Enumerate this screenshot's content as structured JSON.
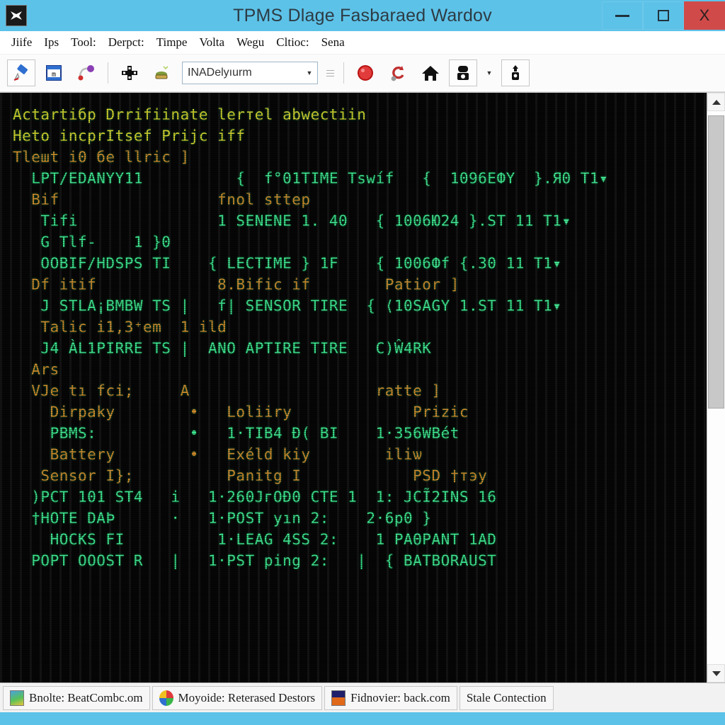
{
  "window": {
    "title": "TPMS Dlage Fasbaraed Wardov",
    "app_icon": "app-icon",
    "controls": {
      "minimize": "–",
      "maximize": "□",
      "close": "X"
    }
  },
  "menubar": {
    "items": [
      {
        "label": "Jiife",
        "hotkey": "J"
      },
      {
        "label": "Ips",
        "hotkey": "I"
      },
      {
        "label": "Tool:",
        "hotkey": "T"
      },
      {
        "label": "Derpct:",
        "hotkey": "D"
      },
      {
        "label": "Timpe",
        "hotkey": ""
      },
      {
        "label": "Volta",
        "hotkey": ""
      },
      {
        "label": "Wegu",
        "hotkey": ""
      },
      {
        "label": "Cltioc:",
        "hotkey": ""
      },
      {
        "label": "Sena",
        "hotkey": ""
      }
    ]
  },
  "toolbar": {
    "buttons": [
      {
        "name": "pen-tool-button",
        "glyph": "✎"
      },
      {
        "name": "table-view-button",
        "glyph": "▦"
      },
      {
        "name": "connect-node-button",
        "glyph": "⚭"
      },
      {
        "name": "grid-layout-button",
        "glyph": "✣"
      },
      {
        "name": "tray-open-button",
        "glyph": "☗"
      }
    ],
    "combo": {
      "value": "INADelyıurm",
      "placeholder": "INADelyıurm"
    },
    "right_buttons": [
      {
        "name": "record-stop-button",
        "glyph": "⬤"
      },
      {
        "name": "refresh-loop-button",
        "glyph": "↻"
      },
      {
        "name": "home-button",
        "glyph": "⌂"
      },
      {
        "name": "device-read-button",
        "glyph": "⛁"
      },
      {
        "name": "sensor-probe-button",
        "glyph": "⚲"
      }
    ]
  },
  "terminal": {
    "lines": [
      {
        "text": "Actartiбp Drrifiinate lerтel abwectiin",
        "color": "yellow"
      },
      {
        "text": "Heto incprItsеf Prijc iff",
        "color": "yellow"
      },
      {
        "text": "Tleшt i0 бe llric ]",
        "color": "orange"
      },
      {
        "text": "  LPT/EDANYY11          {  f°01TIME Tswíf   {  1096EФY  }.Я0 T1▾",
        "color": "green"
      },
      {
        "text": "",
        "color": "green"
      },
      {
        "text": "  Bif                 fnol sttep",
        "color": "orange"
      },
      {
        "text": "   Tifi               1 SENENE 1. 40   { 1006Ю24 }.ST 11 T1▾",
        "color": "green"
      },
      {
        "text": "   G Tlf-    1 }0",
        "color": "green"
      },
      {
        "text": "   OOBIF/HDSPS TI    { LECTIME } 1F    { 1006Фf {.30 11 T1▾",
        "color": "green"
      },
      {
        "text": "",
        "color": "green"
      },
      {
        "text": "  Df itif             8.Bific if        Patior ]",
        "color": "orange"
      },
      {
        "text": "   J STLA¡BMBW TS |   f| SENSOR TIRE  { ⟨10ЅAGY 1.ST 11 T1▾",
        "color": "green"
      },
      {
        "text": "   Talic i1,3⁺em  1 ild",
        "color": "orange"
      },
      {
        "text": "   J4 ÀL1PIRRE TS |  ANO APTIRE TIRE   С)Ŵ4RK",
        "color": "green"
      },
      {
        "text": "",
        "color": "green"
      },
      {
        "text": "",
        "color": "green"
      },
      {
        "text": "  Ars",
        "color": "orange"
      },
      {
        "text": "  VJe tı fci;     A                    ratte ]",
        "color": "orange"
      },
      {
        "text": "    Dirpaky        •   Loliiry             Prizic",
        "color": "orange"
      },
      {
        "text": "    PBMS:          •   1·TIB4 Đ( BI    1·356WBét",
        "color": "green"
      },
      {
        "text": "    Battery        •   Exéld kiy        iliѡ",
        "color": "orange"
      },
      {
        "text": "   Sensor I};          Panitg I            PSD †тэy",
        "color": "orange"
      },
      {
        "text": "  )PCT 101 ST4   i   1·260JгOĐ0 CTE 1  1: JCĨ2INS 16",
        "color": "green"
      },
      {
        "text": "  †HOTE DAÞ      ·   1·POST yın 2:    2·6р0 }",
        "color": "green"
      },
      {
        "text": "    HOCKS FI          1·LEAG 4SS 2:    1 PAΘPANT 1AD",
        "color": "green"
      },
      {
        "text": "  POPT OOOST R   |   1·PST ping 2:   |  { BATBORAUST",
        "color": "green"
      }
    ],
    "colors": {
      "green": "#3ee58f",
      "yellow": "#d6d32e",
      "orange": "#cf8a2c",
      "background": "#060606"
    }
  },
  "scrollbar": {
    "up_arrow": "scroll-up",
    "down_arrow": "scroll-down",
    "thumb_position_percent": 0,
    "thumb_size_percent": 53
  },
  "statusbar": {
    "tasks": [
      {
        "label": "Bnolte: BeatCombc.om",
        "icon": "image-viewer-icon"
      },
      {
        "label": "Moyoide: Reterased Destors",
        "icon": "browser-icon"
      },
      {
        "label": "Fidnovier: back.com",
        "icon": "media-icon"
      },
      {
        "label": "Stale Contection",
        "icon": ""
      }
    ]
  }
}
